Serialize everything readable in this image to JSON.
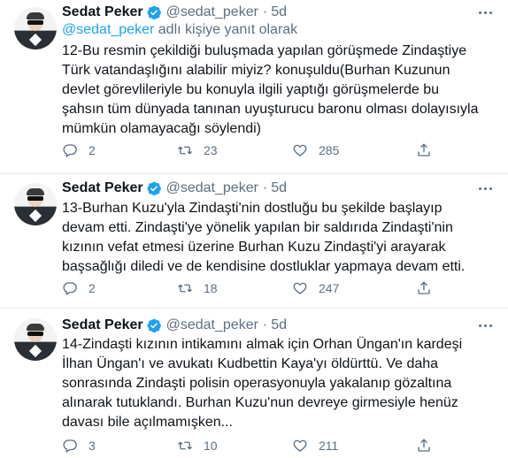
{
  "author": {
    "name": "Sedat Peker",
    "handle": "@sedat_peker",
    "separator": "·",
    "time": "5d"
  },
  "reply_to": {
    "mention": "@sedat_peker",
    "suffix": "adlı kişiye yanıt olarak"
  },
  "icons": {
    "verified": "verified-badge-icon",
    "reply": "reply-icon",
    "retweet": "retweet-icon",
    "like": "heart-icon",
    "share": "share-icon",
    "more": "more-icon"
  },
  "colors": {
    "accent": "#1da1f2",
    "secondary_text": "#5b7083",
    "separator": "#e6ecf0"
  },
  "tweets": [
    {
      "lines": [
        "12-Bu resmin çekildiği buluşmada yapılan görüşmede Zindaştiye",
        "Türk vatandaşlığını alabilir miyiz? konuşuldu(Burhan Kuzunun",
        "devlet görevlileriyle bu konuyla ilgili yaptığı görüşmelerde bu",
        "şahsın tüm dünyada tanınan uyuşturucu baronu olması dolayısıyla",
        "mümkün olamayacağı söylendi)"
      ],
      "replies": "2",
      "retweets": "23",
      "likes": "285"
    },
    {
      "lines": [
        "13-Burhan Kuzu'yla Zindaşti'nin dostluğu bu şekilde başlayıp",
        "devam etti. Zindaşti'ye yönelik yapılan bir saldırıda Zindaşti'nin",
        "kızının vefat etmesi üzerine Burhan Kuzu Zindaşti'yi arayarak",
        "başsağlığı diledi ve de kendisine dostluklar yapmaya devam etti."
      ],
      "replies": "2",
      "retweets": "18",
      "likes": "247"
    },
    {
      "lines": [
        "14-Zindaşti kızının intikamını almak için Orhan Üngan'ın kardeşi",
        "İlhan Üngan'ı ve avukatı Kudbettin Kaya'yı öldürttü. Ve daha",
        "sonrasında Zindaşti polisin operasyonuyla yakalanıp gözaltına",
        "alınarak tutuklandı. Burhan Kuzu'nun devreye girmesiyle henüz",
        "davası bile açılmamışken..."
      ],
      "replies": "3",
      "retweets": "10",
      "likes": "211"
    }
  ]
}
